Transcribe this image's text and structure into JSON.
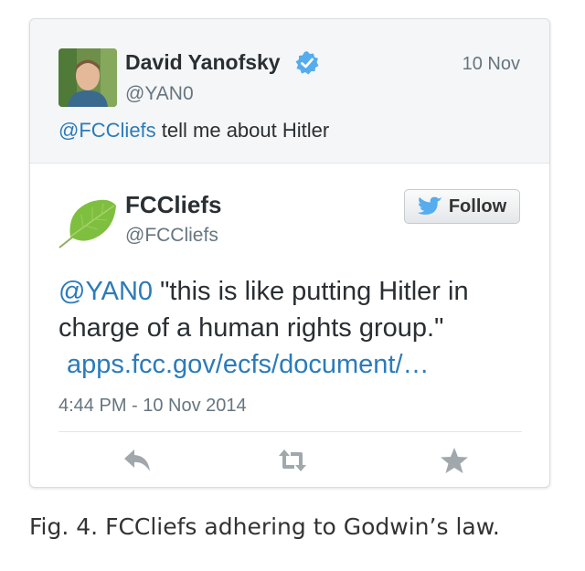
{
  "parent_tweet": {
    "author_name": "David Yanofsky",
    "handle": "@YAN0",
    "date": "10 Nov",
    "mention": "@FCCliefs",
    "text": " tell me about Hitler"
  },
  "main_tweet": {
    "author_name": "FCCliefs",
    "handle": "@FCCliefs",
    "follow_label": "Follow",
    "mention": "@YAN0",
    "text": " \"this is like putting Hitler in charge of a human rights group.\"",
    "link": "apps.fcc.gov/ecfs/document/…",
    "timestamp": "4:44 PM - 10 Nov 2014"
  },
  "actions": [
    "reply-icon",
    "retweet-icon",
    "favorite-icon"
  ],
  "caption": "Fig. 4. FCCliefs adhering to Godwin’s law.",
  "colors": {
    "link": "#2b7bb9",
    "verified": "#55acee",
    "twitter_bird": "#55acee",
    "muted": "#66757f",
    "action_icon": "#a0a8ae"
  }
}
